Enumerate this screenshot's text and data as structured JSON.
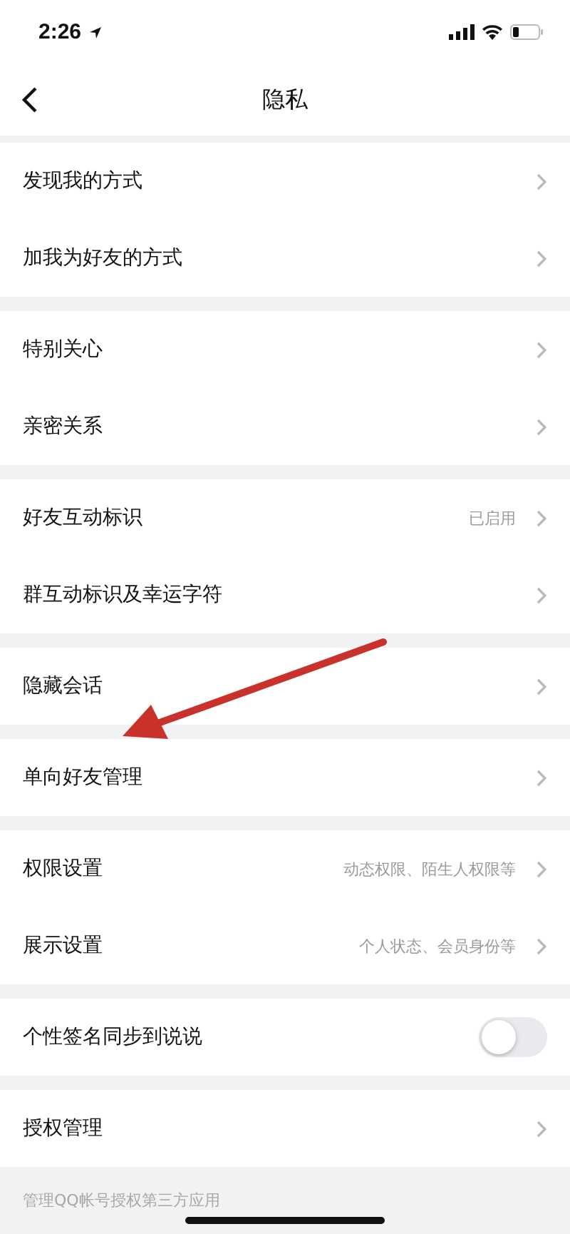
{
  "status_bar": {
    "time": "2:26"
  },
  "nav": {
    "title": "隐私"
  },
  "groups": [
    {
      "rows": [
        {
          "kind": "link",
          "label": "发现我的方式"
        },
        {
          "kind": "link",
          "label": "加我为好友的方式"
        }
      ]
    },
    {
      "rows": [
        {
          "kind": "link",
          "label": "特别关心"
        },
        {
          "kind": "link",
          "label": "亲密关系"
        }
      ]
    },
    {
      "rows": [
        {
          "kind": "link",
          "label": "好友互动标识",
          "value": "已启用"
        },
        {
          "kind": "link",
          "label": "群互动标识及幸运字符"
        }
      ]
    },
    {
      "rows": [
        {
          "kind": "link",
          "label": "隐藏会话"
        }
      ]
    },
    {
      "rows": [
        {
          "kind": "link",
          "label": "单向好友管理"
        }
      ]
    },
    {
      "rows": [
        {
          "kind": "link",
          "label": "权限设置",
          "value": "动态权限、陌生人权限等"
        },
        {
          "kind": "link",
          "label": "展示设置",
          "value": "个人状态、会员身份等"
        }
      ]
    },
    {
      "rows": [
        {
          "kind": "toggle",
          "label": "个性签名同步到说说",
          "on": false
        }
      ]
    },
    {
      "rows": [
        {
          "kind": "link",
          "label": "授权管理"
        }
      ]
    }
  ],
  "footer_note": "管理QQ帐号授权第三方应用"
}
